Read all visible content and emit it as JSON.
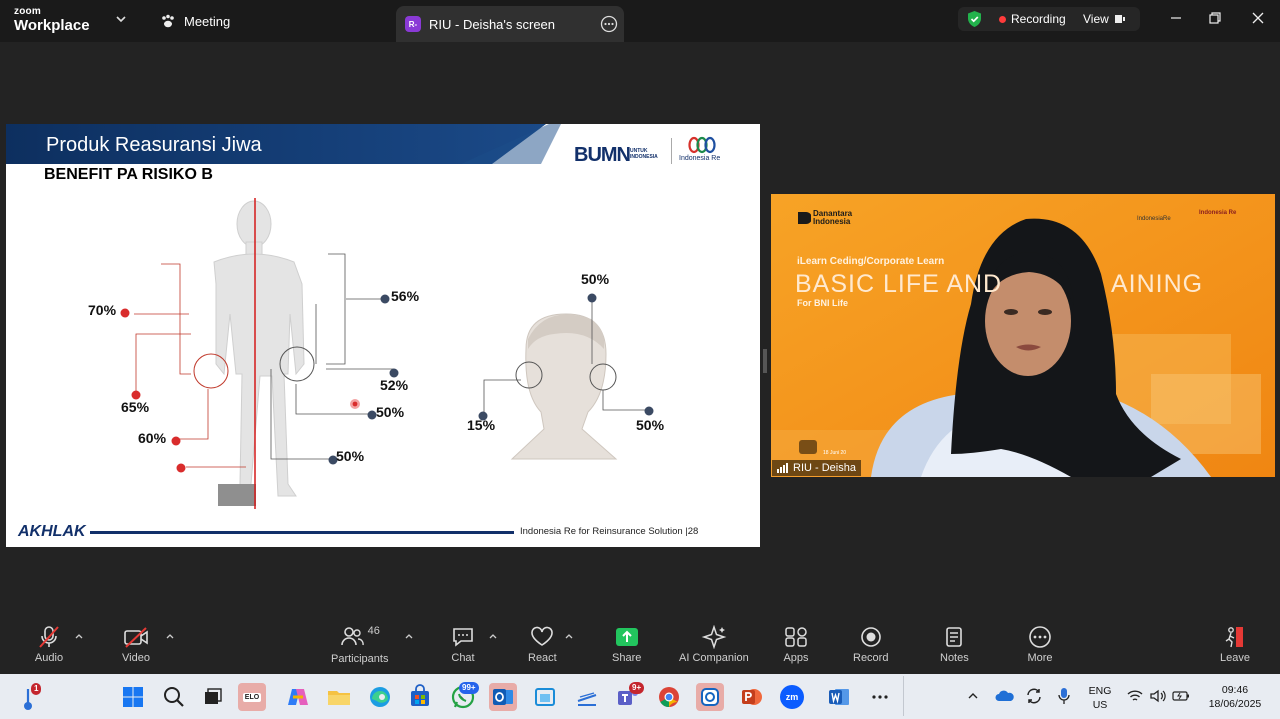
{
  "app": {
    "brand_top": "zoom",
    "brand_bottom": "Workplace"
  },
  "tabs": {
    "meeting_label": "Meeting",
    "share_badge": "R-",
    "share_label": "RIU - Deisha's screen"
  },
  "status": {
    "recording_label": "Recording",
    "view_label": "View"
  },
  "slide": {
    "title": "Produk Reasuransi Jiwa",
    "subtitle": "BENEFIT PA RISIKO B",
    "logo_bumn": "BUMN",
    "logo_bumn_sub": "UNTUK INDONESIA",
    "logo_ir": "Indonesia Re",
    "body_labels": [
      "70%",
      "65%",
      "60%",
      "56%",
      "52%",
      "50%",
      "50%"
    ],
    "head_labels": [
      "50%",
      "15%",
      "50%"
    ],
    "footer_brand": "AKHLAK",
    "footer_text": "Indonesia Re for Reinsurance Solution  |28"
  },
  "video": {
    "participant_name": "RIU - Deisha",
    "bg_brand": "Danantara Indonesia",
    "bg_program": "iLearn Ceding/Corporate Learn",
    "bg_title": "BASIC LIFE AND",
    "bg_title_end": "AINING",
    "bg_for": "For BNI Life",
    "bg_ir1": "IndonesiaRe",
    "bg_ir2": "Indonesia Re",
    "bg_date": "18 Juni 20"
  },
  "toolbar": {
    "audio": "Audio",
    "video": "Video",
    "participants": "Participants",
    "participants_count": "46",
    "chat": "Chat",
    "react": "React",
    "share": "Share",
    "ai": "AI Companion",
    "apps": "Apps",
    "record": "Record",
    "notes": "Notes",
    "more": "More",
    "leave": "Leave"
  },
  "taskbar": {
    "weather_badge": "1",
    "chat_badge": "99+",
    "teams_badge": "9+",
    "elo": "ELO",
    "zoom": "zm",
    "lang1": "ENG",
    "lang2": "US",
    "time": "09:46",
    "date": "18/06/2025"
  },
  "colors": {
    "accent_red": "#d92c2c",
    "zoom_blue": "#0b5cff",
    "share_green": "#22c55e",
    "slide_navy": "#12306a"
  }
}
